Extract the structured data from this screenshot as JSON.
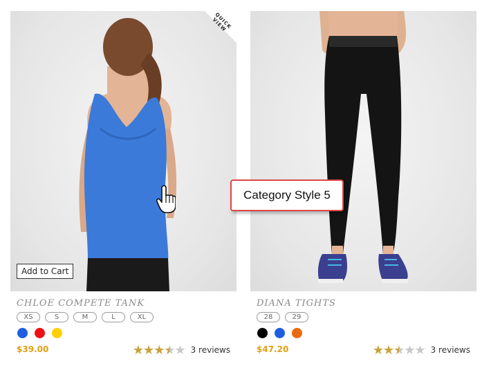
{
  "callout": {
    "label": "Category Style 5"
  },
  "products": [
    {
      "name": "Chloe Compete Tank",
      "quick_view": "QUICK VIEW",
      "add_to_cart": "Add to Cart",
      "sizes": [
        "XS",
        "S",
        "M",
        "L",
        "XL"
      ],
      "colors": [
        "#1f5ee0",
        "#ee1111",
        "#ffd000"
      ],
      "price": "$39.00",
      "rating": 3.5,
      "rating_max": 5,
      "reviews": "3 reviews",
      "image_icon": "tank-top-model-photo"
    },
    {
      "name": "Diana Tights",
      "sizes": [
        "28",
        "29"
      ],
      "colors": [
        "#000000",
        "#1f5ee0",
        "#e96a10"
      ],
      "price": "$47.20",
      "rating": 2.5,
      "rating_max": 5,
      "reviews": "3 reviews",
      "image_icon": "tights-model-photo"
    }
  ],
  "cursor": {
    "icon": "hand-pointer-icon"
  },
  "colors": {
    "price": "#e0a014",
    "star": "#c9a23a",
    "callout_border": "#e04646"
  }
}
